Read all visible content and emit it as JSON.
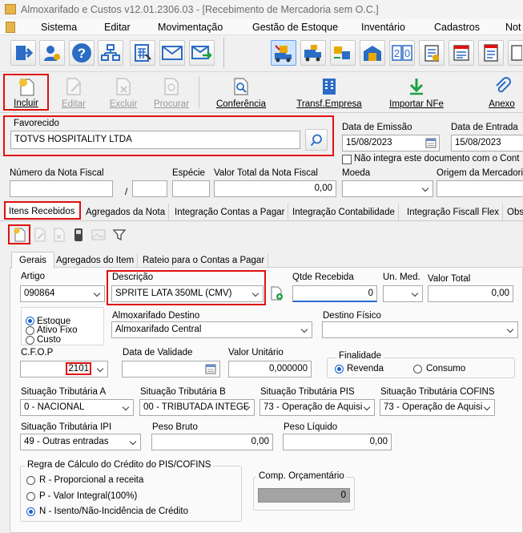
{
  "window": {
    "title": "Almoxarifado e Custos v12.01.2306.03 - [Recebimento de Mercadoria sem O.C.]"
  },
  "menu": [
    "Sistema",
    "Editar",
    "Movimentação",
    "Gestão de Estoque",
    "Inventário",
    "Cadastros",
    "Not"
  ],
  "actions": {
    "incluir": "Incluir",
    "editar": "Editar",
    "excluir": "Excluir",
    "procurar": "Procurar",
    "conferencia": "Conferência",
    "transf": "Transf.Empresa",
    "importar": "Importar NFe",
    "anexo": "Anexo"
  },
  "header": {
    "favorecido_label": "Favorecido",
    "favorecido_value": "TOTVS HOSPITALITY LTDA",
    "data_emissao_label": "Data de Emissão",
    "data_emissao": "15/08/2023",
    "data_entrada_label": "Data de Entrada",
    "data_entrada": "15/08/2023",
    "nao_integra": "Não integra este documento com o Cont",
    "numero_nf_label": "Número da Nota Fiscal",
    "especie_label": "Espécie",
    "valor_total_label": "Valor Total da Nota Fiscal",
    "valor_total": "0,00",
    "moeda_label": "Moeda",
    "origem_label": "Origem da Mercadori",
    "slash": "/"
  },
  "main_tabs": [
    "Itens Recebidos",
    "Agregados da Nota",
    "Integração Contas a Pagar",
    "Integração Contabilidade",
    "Integração Fiscall Flex",
    "Obs"
  ],
  "sub_tabs": [
    "Gerais",
    "Agregados do Item",
    "Rateio para o Contas a Pagar"
  ],
  "item": {
    "artigo_label": "Artigo",
    "artigo": "090864",
    "descricao_label": "Descrição",
    "descricao": "SPRITE LATA 350ML (CMV)",
    "qtde_label": "Qtde Recebida",
    "qtde": "0",
    "unmed_label": "Un. Med.",
    "valor_total_label": "Valor Total",
    "valor_total": "0,00",
    "tipo_options": [
      "Estoque",
      "Ativo Fixo",
      "Custo"
    ],
    "almox_dest_label": "Almoxarifado Destino",
    "almox_dest": "Almoxarifado Central",
    "destino_fisico_label": "Destino Físico",
    "cfop_label": "C.F.O.P",
    "cfop": "2101",
    "validade_label": "Data de Validade",
    "valor_unit_label": "Valor Unitário",
    "valor_unit": "0,000000",
    "finalidade_label": "Finalidade",
    "finalidade_options": [
      "Revenda",
      "Consumo"
    ],
    "sit_a_label": "Situação Tributária A",
    "sit_a": "0 - NACIONAL",
    "sit_b_label": "Situação Tributária B",
    "sit_b": "00 - TRIBUTADA INTEGF",
    "sit_pis_label": "Situação Tributária PIS",
    "sit_pis": "73 - Operação de Aquisi",
    "sit_cofins_label": "Situação Tributária COFINS",
    "sit_cofins": "73 - Operação de Aquisi",
    "sit_ipi_label": "Situação Tributária IPI",
    "sit_ipi": "49 - Outras entradas",
    "peso_bruto_label": "Peso Bruto",
    "peso_bruto": "0,00",
    "peso_liquido_label": "Peso Líquido",
    "peso_liquido": "0,00",
    "regra_label": "Regra de Cálculo do Crédito do PIS/COFINS",
    "regra_options": [
      "R - Proporcional a receita",
      "P - Valor Integral(100%)",
      "N - Isento/Não-Incidência de Crédito"
    ],
    "comp_orc_label": "Comp. Orçamentário",
    "comp_orc": "0"
  },
  "colors": {
    "highlight": "#e01010",
    "accent": "#1a5fd0"
  }
}
